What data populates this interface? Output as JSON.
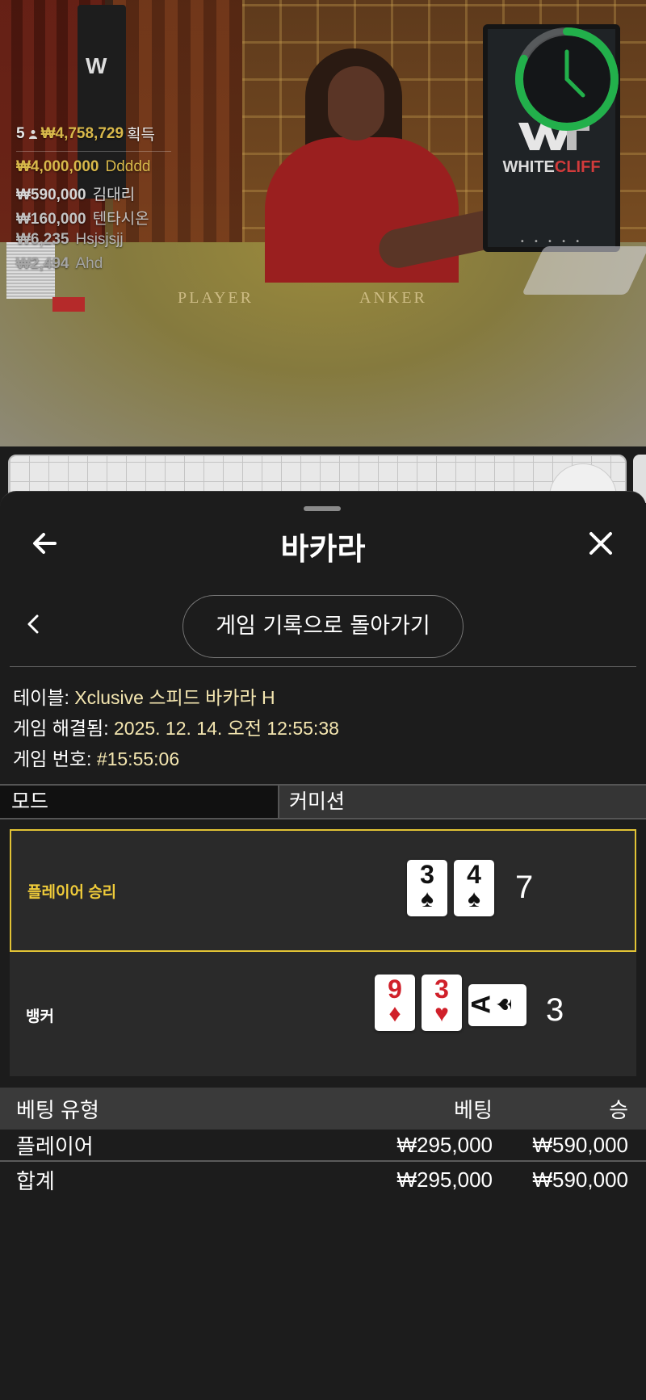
{
  "winners": {
    "count": "5",
    "total": "₩4,758,729",
    "suffix": "획득",
    "list": [
      {
        "amount": "₩4,000,000",
        "name": "Ddddd",
        "color": "#d8b84a"
      },
      {
        "amount": "₩590,000",
        "name": "김대리",
        "color": "#d6d6d6"
      },
      {
        "amount": "₩160,000",
        "name": "텐타시온",
        "color": "#c4c4c4"
      },
      {
        "amount": "₩6,235",
        "name": "Hsjsjsjj",
        "color": "#b5b5b5"
      },
      {
        "amount": "₩2,494",
        "name": "Ahd",
        "color": "#a5a5a5"
      }
    ]
  },
  "video": {
    "table_player": "PLAYER",
    "table_banker": "ANKER",
    "monitor_brand": "WHITE",
    "monitor_brand_accent": "CLIFF",
    "monitor_dots": "• • • • •",
    "left_monitor_logo": "W"
  },
  "timer": {
    "progress": 0.82,
    "color": "#22b04b"
  },
  "sheet": {
    "title": "바카라",
    "back_button": "게임 기록으로 돌아가기",
    "info": {
      "table_label": "테이블: ",
      "table_value": "Xclusive 스피드 바카라 H",
      "resolved_label": "게임 해결됨: ",
      "resolved_value": "2025. 12. 14. 오전 12:55:38",
      "number_label": "게임 번호: ",
      "number_value": "#15:55:06"
    },
    "mode": {
      "label": "모드",
      "value": "커미션"
    },
    "player": {
      "label": "플레이어 승리",
      "label_color": "#f0cc3a",
      "cards": [
        {
          "rank": "3",
          "suit": "♠",
          "color": "black"
        },
        {
          "rank": "4",
          "suit": "♠",
          "color": "black"
        }
      ],
      "score": "7"
    },
    "banker": {
      "label": "뱅커",
      "cards": [
        {
          "rank": "9",
          "suit": "♦",
          "color": "red"
        },
        {
          "rank": "3",
          "suit": "♥",
          "color": "red"
        },
        {
          "rank": "A",
          "suit": "♠",
          "color": "black",
          "sideways": true
        }
      ],
      "score": "3"
    },
    "bets": {
      "headers": {
        "type": "베팅 유형",
        "bet": "베팅",
        "win": "승"
      },
      "rows": [
        {
          "type": "플레이어",
          "bet": "₩295,000",
          "win": "₩590,000"
        }
      ],
      "total": {
        "type": "합계",
        "bet": "₩295,000",
        "win": "₩590,000"
      }
    }
  }
}
